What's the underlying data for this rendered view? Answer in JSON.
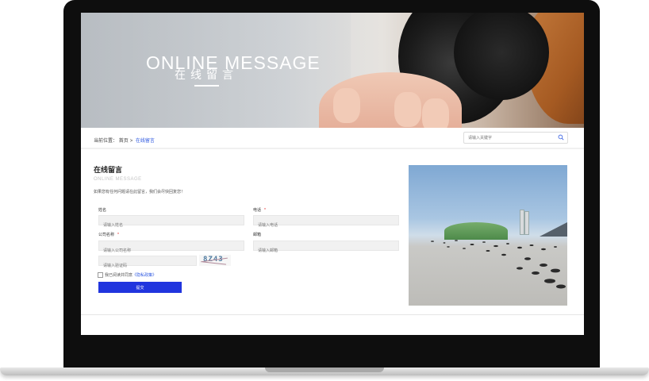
{
  "banner": {
    "title_en": "ONLINE MESSAGE",
    "title_cn": "在线留言"
  },
  "breadcrumb": {
    "label": "当前位置：",
    "home": "首页",
    "separator": ">",
    "current": "在线留言"
  },
  "search": {
    "placeholder": "请输入关键字"
  },
  "form": {
    "title": "在线留言",
    "title_en": "ONLINE MESSAGE",
    "intro": "如果您有任何问题请在此留言，我们会尽快回复您！",
    "fields": {
      "name_label": "姓名",
      "name_placeholder": "请输入姓名",
      "phone_label": "电话",
      "phone_required": "*",
      "phone_placeholder": "请输入电话",
      "company_label": "公司名称",
      "company_required": "*",
      "company_placeholder": "请输入公司名称",
      "email_label": "邮箱",
      "email_placeholder": "请输入邮箱",
      "captcha_placeholder": "请输入验证码",
      "captcha_code": "8Z43"
    },
    "agree_text": "我已阅读并同意",
    "agree_link": "《隐私政策》",
    "submit_label": "提交"
  },
  "colors": {
    "accent": "#2135de",
    "required": "#e02020",
    "link": "#2b56e0"
  }
}
